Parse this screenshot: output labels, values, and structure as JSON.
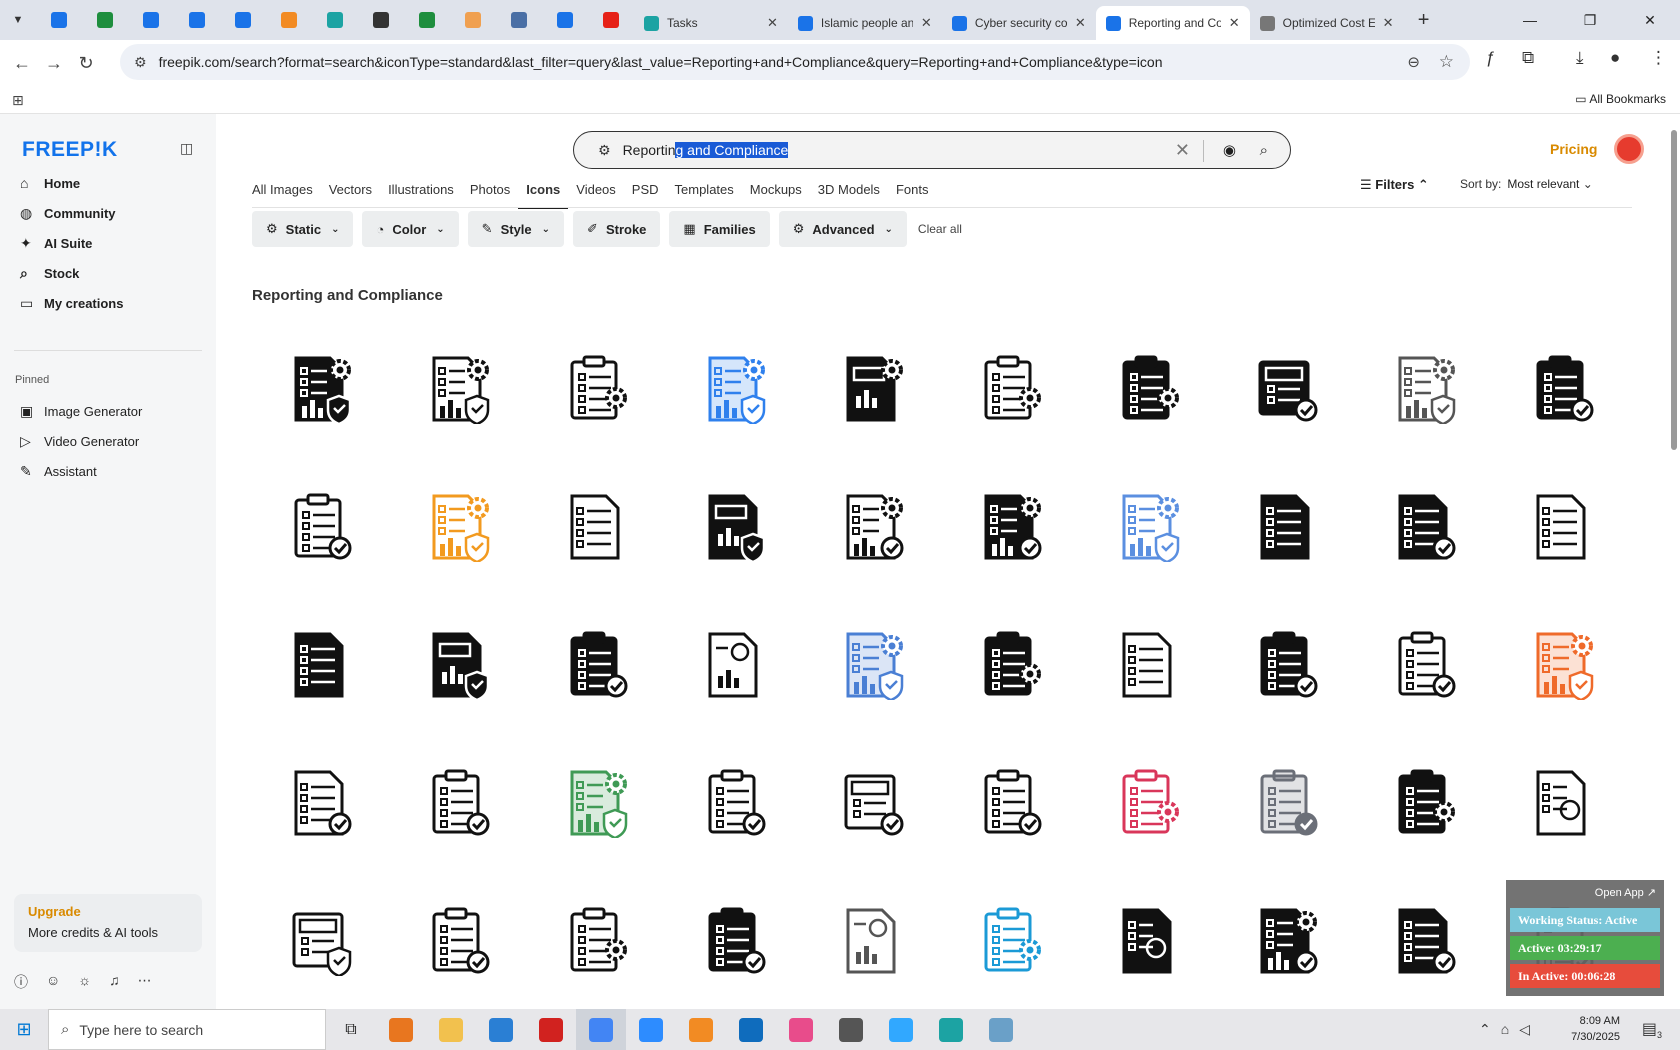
{
  "browser": {
    "pinned_tab_colors": [
      "#1a73e8",
      "#1e8e3e",
      "#1a73e8",
      "#1a73e8",
      "#1a73e8",
      "#f28b23",
      "#1ca3a3",
      "#333333",
      "#1e8e3e",
      "#f0a050",
      "#4a6fa5",
      "#1a73e8",
      "#e62117"
    ],
    "tabs": [
      {
        "title": "Tasks",
        "color": "#1ca3a3",
        "active": false
      },
      {
        "title": "Islamic people an",
        "color": "#1a73e8",
        "active": false
      },
      {
        "title": "Cyber security co",
        "color": "#1a73e8",
        "active": false
      },
      {
        "title": "Reporting and Co",
        "color": "#1a73e8",
        "active": true
      },
      {
        "title": "Optimized Cost E",
        "color": "#777777",
        "active": false
      }
    ],
    "url": "freepik.com/search?format=search&iconType=standard&last_filter=query&last_value=Reporting+and+Compliance&query=Reporting+and+Compliance&type=icon",
    "all_bookmarks": "All Bookmarks"
  },
  "sidebar": {
    "logo": "FREEP!K",
    "nav": [
      {
        "label": "Home",
        "icon": "⌂"
      },
      {
        "label": "Community",
        "icon": "◍"
      },
      {
        "label": "AI Suite",
        "icon": "✦"
      },
      {
        "label": "Stock",
        "icon": "⌕"
      },
      {
        "label": "My creations",
        "icon": "▭"
      }
    ],
    "pinned_label": "Pinned",
    "pinned": [
      {
        "label": "Image Generator",
        "icon": "▣"
      },
      {
        "label": "Video Generator",
        "icon": "▷"
      },
      {
        "label": "Assistant",
        "icon": "✎"
      }
    ],
    "upgrade_title": "Upgrade",
    "upgrade_subtitle": "More credits & AI tools"
  },
  "search": {
    "value_plain": "Reportin",
    "value_selected": "g and Compliance"
  },
  "header": {
    "pricing": "Pricing"
  },
  "types": [
    "All Images",
    "Vectors",
    "Illustrations",
    "Photos",
    "Icons",
    "Videos",
    "PSD",
    "Templates",
    "Mockups",
    "3D Models",
    "Fonts"
  ],
  "active_type": "Icons",
  "filters_label": "Filters",
  "sort": {
    "label": "Sort by:",
    "value": "Most relevant"
  },
  "chips": [
    {
      "label": "Static",
      "icon": "⚙",
      "dropdown": true
    },
    {
      "label": "Color",
      "icon": "◔",
      "dropdown": true
    },
    {
      "label": "Style",
      "icon": "✎",
      "dropdown": true
    },
    {
      "label": "Stroke",
      "icon": "✐",
      "dropdown": false
    },
    {
      "label": "Families",
      "icon": "▦",
      "dropdown": false
    },
    {
      "label": "Advanced",
      "icon": "⚙",
      "dropdown": true
    }
  ],
  "clear_all": "Clear all",
  "results_title": "Reporting and Compliance",
  "icons": [
    {
      "kind": "doc-gear-shield",
      "fill": "solid",
      "color": "#111111"
    },
    {
      "kind": "doc-gear-shield",
      "fill": "outline",
      "color": "#111111"
    },
    {
      "kind": "clipboard-gear",
      "fill": "outline",
      "color": "#111111"
    },
    {
      "kind": "doc-gear-shield",
      "fill": "color",
      "color": "#2f80ed"
    },
    {
      "kind": "doc-chart-gear",
      "fill": "solid",
      "color": "#111111"
    },
    {
      "kind": "clipboard-gear",
      "fill": "outline",
      "color": "#111111"
    },
    {
      "kind": "clipboard-gear",
      "fill": "solid",
      "color": "#111111"
    },
    {
      "kind": "form-check",
      "fill": "solid",
      "color": "#111111"
    },
    {
      "kind": "doc-gear-shield",
      "fill": "outline",
      "color": "#555555"
    },
    {
      "kind": "clipboard-check",
      "fill": "solid",
      "color": "#111111"
    },
    {
      "kind": "clipboard-check",
      "fill": "outline",
      "color": "#111111"
    },
    {
      "kind": "doc-gear-shield",
      "fill": "outline",
      "color": "#f29a1f"
    },
    {
      "kind": "doc-checklist",
      "fill": "outline",
      "color": "#111111"
    },
    {
      "kind": "doc-chart-shield",
      "fill": "solid",
      "color": "#111111"
    },
    {
      "kind": "doc-gear-check",
      "fill": "outline",
      "color": "#111111"
    },
    {
      "kind": "doc-gear-check",
      "fill": "solid",
      "color": "#111111"
    },
    {
      "kind": "doc-gear-shield",
      "fill": "outline",
      "color": "#5b8fe0"
    },
    {
      "kind": "doc-checklist",
      "fill": "solid",
      "color": "#111111"
    },
    {
      "kind": "doc-check",
      "fill": "solid",
      "color": "#111111"
    },
    {
      "kind": "doc-checklist",
      "fill": "outline",
      "color": "#111111"
    },
    {
      "kind": "doc-checklist",
      "fill": "solid",
      "color": "#111111"
    },
    {
      "kind": "doc-chart-shield",
      "fill": "solid",
      "color": "#111111"
    },
    {
      "kind": "clipboard-check",
      "fill": "solid",
      "color": "#111111"
    },
    {
      "kind": "doc-pie",
      "fill": "outline",
      "color": "#111111"
    },
    {
      "kind": "doc-gear-shield",
      "fill": "color",
      "color": "#4a7fd4"
    },
    {
      "kind": "clipboard-gear",
      "fill": "solid",
      "color": "#111111"
    },
    {
      "kind": "doc-checklist",
      "fill": "outline",
      "color": "#111111"
    },
    {
      "kind": "clipboard-check",
      "fill": "solid",
      "color": "#111111"
    },
    {
      "kind": "clipboard-check",
      "fill": "outline",
      "color": "#111111"
    },
    {
      "kind": "doc-gear-shield",
      "fill": "color",
      "color": "#ef6a2a"
    },
    {
      "kind": "doc-check",
      "fill": "outline",
      "color": "#111111"
    },
    {
      "kind": "clipboard-check",
      "fill": "outline",
      "color": "#111111"
    },
    {
      "kind": "doc-gear-shield",
      "fill": "color",
      "color": "#3f9a55"
    },
    {
      "kind": "clipboard-check",
      "fill": "outline",
      "color": "#111111"
    },
    {
      "kind": "form-check",
      "fill": "outline",
      "color": "#111111"
    },
    {
      "kind": "clipboard-check",
      "fill": "outline",
      "color": "#111111"
    },
    {
      "kind": "clipboard-gear",
      "fill": "outline",
      "color": "#d9365a"
    },
    {
      "kind": "clipboard-check",
      "fill": "color",
      "color": "#6b6f78"
    },
    {
      "kind": "clipboard-gear",
      "fill": "solid",
      "color": "#111111"
    },
    {
      "kind": "doc-award",
      "fill": "outline",
      "color": "#111111"
    },
    {
      "kind": "form-shield",
      "fill": "outline",
      "color": "#111111"
    },
    {
      "kind": "clipboard-check",
      "fill": "outline",
      "color": "#111111"
    },
    {
      "kind": "clipboard-gear",
      "fill": "outline",
      "color": "#111111"
    },
    {
      "kind": "clipboard-check",
      "fill": "solid",
      "color": "#111111"
    },
    {
      "kind": "doc-pie",
      "fill": "outline",
      "color": "#555555"
    },
    {
      "kind": "clipboard-gear",
      "fill": "outline",
      "color": "#1b9ad6"
    },
    {
      "kind": "doc-award",
      "fill": "solid",
      "color": "#111111"
    },
    {
      "kind": "doc-gear-check",
      "fill": "solid",
      "color": "#111111"
    },
    {
      "kind": "doc-check",
      "fill": "solid",
      "color": "#111111"
    },
    {
      "kind": "clipboard-check",
      "fill": "outline",
      "color": "#888888"
    }
  ],
  "tracker": {
    "open_app": "Open App ↗",
    "status": "Working Status: Active",
    "active": "Active: 03:29:17",
    "inactive": "In Active: 00:06:28",
    "colors": [
      "#7ac6d8",
      "#4caf50",
      "#e74c3c"
    ]
  },
  "taskbar": {
    "search_placeholder": "Type here to search",
    "app_colors": [
      "#e8761f",
      "#f2c14e",
      "#2a7fd4",
      "#d1221f",
      "#4285f4",
      "#2d8cff",
      "#f28b23",
      "#0f6cbd",
      "#e84c8b",
      "#555555",
      "#31a8ff",
      "#1ca3a3",
      "#6aa0c8"
    ],
    "time": "8:09 AM",
    "date": "7/30/2025",
    "notification_count": "3"
  }
}
